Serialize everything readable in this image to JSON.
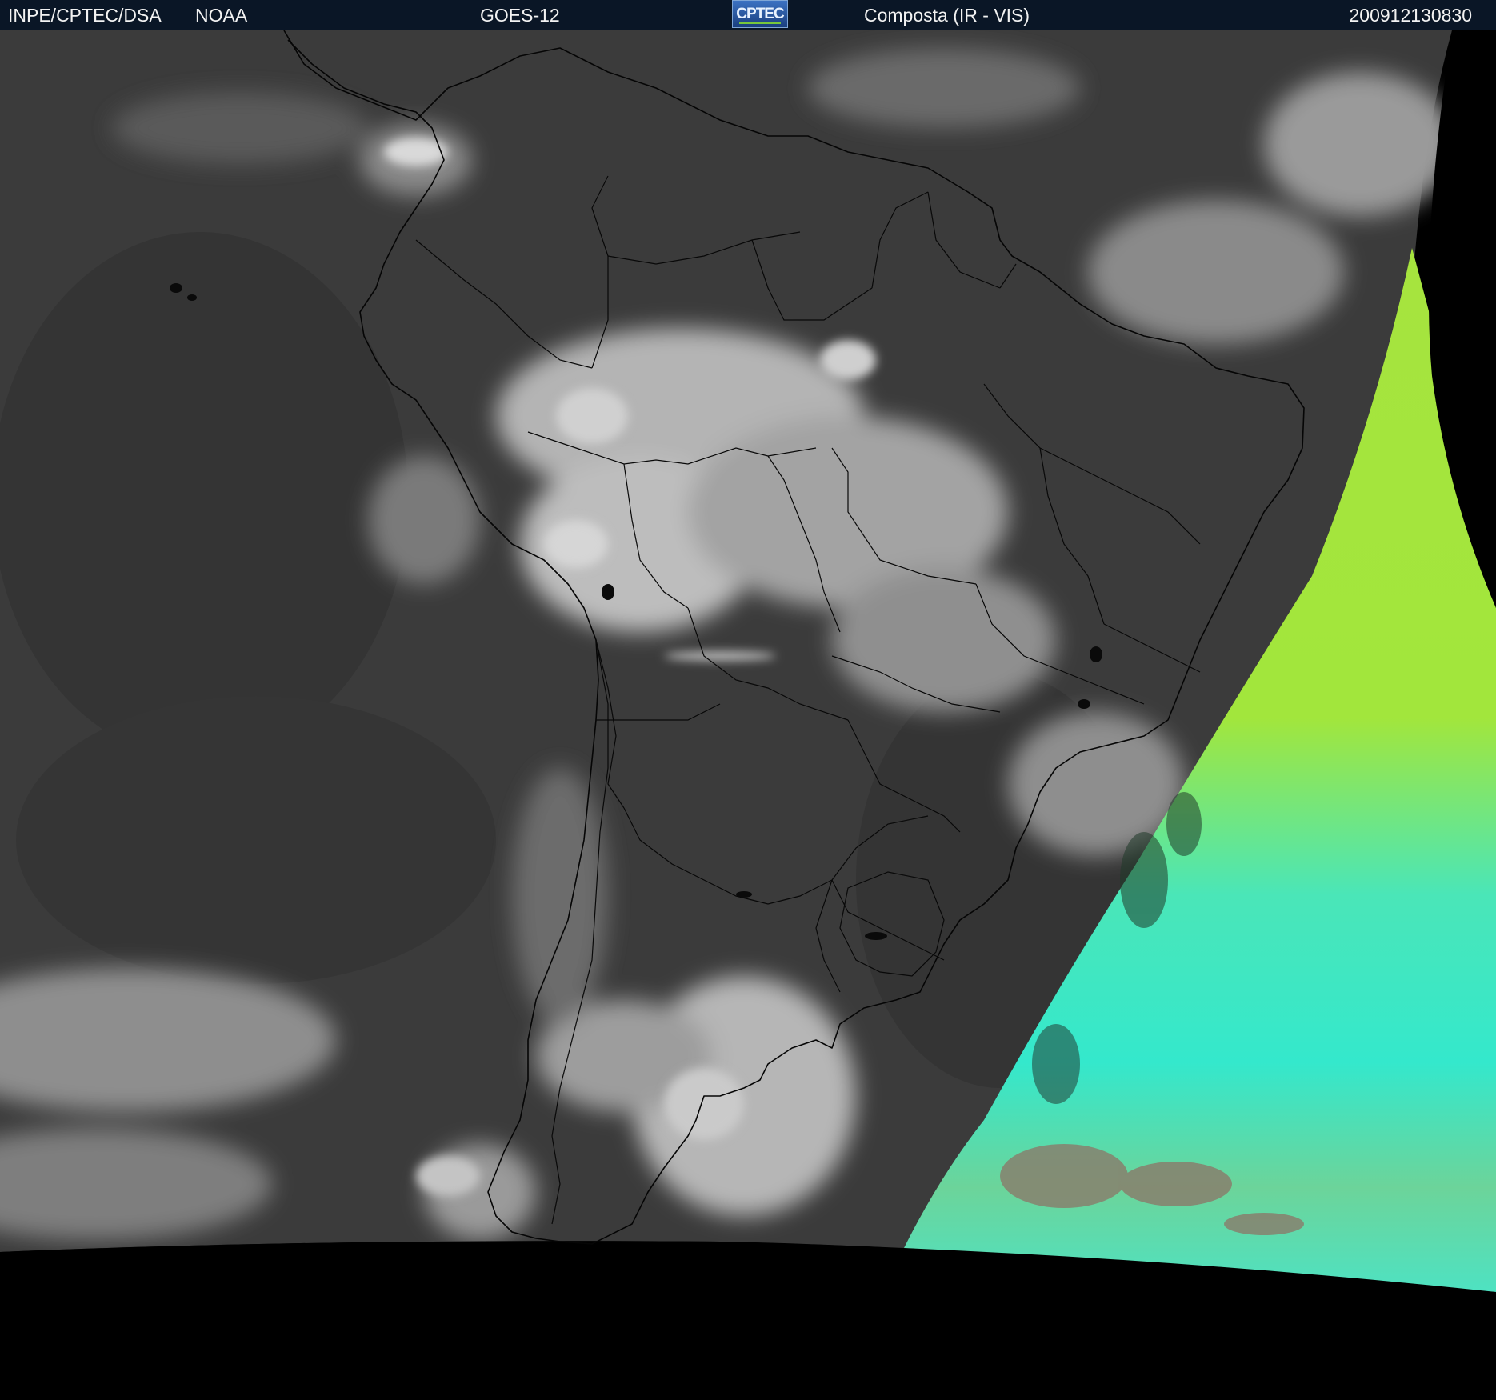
{
  "header": {
    "organization": "INPE/CPTEC/DSA",
    "agency": "NOAA",
    "satellite": "GOES-12",
    "logo_text": "CPTEC",
    "product": "Composta (IR - VIS)",
    "timestamp": "200912130830"
  },
  "imagery": {
    "region": "South America",
    "background_color": "#000000",
    "ocean_ir_color": "#3a3a3a",
    "cloud_color": "#d9d9d9",
    "vis_sector_colors": [
      "#a4e43c",
      "#38e6c8",
      "#7a7068"
    ],
    "border_line_color": "#000000"
  }
}
